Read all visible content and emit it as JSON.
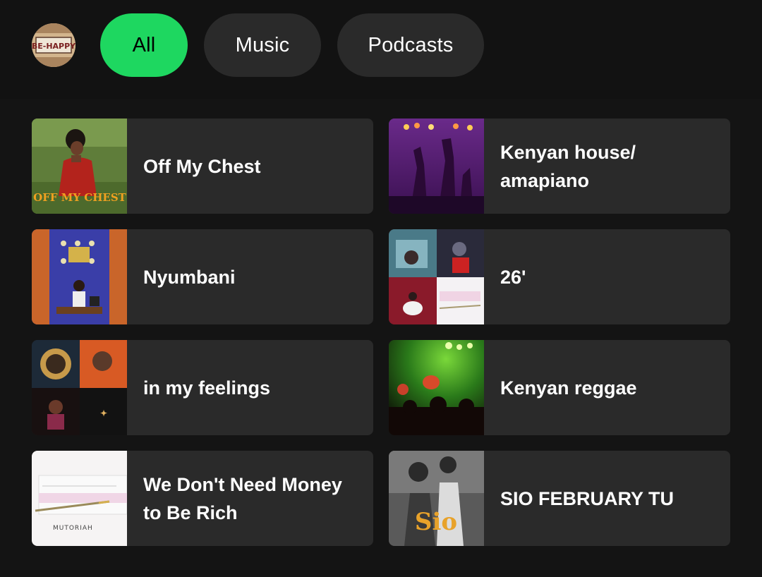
{
  "filters": {
    "all": "All",
    "music": "Music",
    "podcasts": "Podcasts"
  },
  "avatar": {
    "label": "BE-HAPPY"
  },
  "cards": [
    {
      "title": "Off My Chest",
      "art_text": "OFF MY CHEST"
    },
    {
      "title": "Kenyan house/ amapiano"
    },
    {
      "title": "Nyumbani"
    },
    {
      "title": "26'"
    },
    {
      "title": "in my feelings"
    },
    {
      "title": "Kenyan reggae"
    },
    {
      "title": "We Don't Need Money to Be Rich",
      "art_text": "MUTORIAH"
    },
    {
      "title": "SIO FEBRUARY TU",
      "art_text": "Sio"
    }
  ],
  "colors": {
    "accent": "#1ed760",
    "background": "#121212",
    "card": "#2a2a2a",
    "chip": "#2a2a2a"
  }
}
